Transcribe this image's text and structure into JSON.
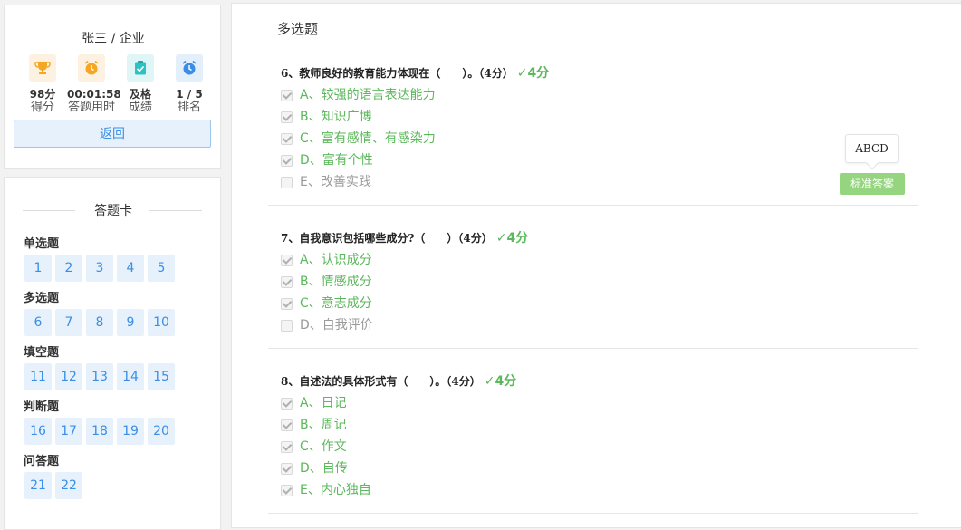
{
  "user": {
    "name": "张三 / 企业",
    "stats": [
      {
        "icon": "trophy-icon",
        "color": "#f5a623",
        "bg": "#fdf2e1",
        "value": "98分",
        "label": "得分"
      },
      {
        "icon": "alarm-clock-icon",
        "color": "#f5a623",
        "bg": "#fdf2e1",
        "value": "00:01:58",
        "label": "答题用时"
      },
      {
        "icon": "clipboard-check-icon",
        "color": "#2ec1c1",
        "bg": "#e0f6f6",
        "value": "及格",
        "label": "成绩"
      },
      {
        "icon": "alarm-clock-icon",
        "color": "#3a8ee6",
        "bg": "#e3effb",
        "value": "1 / 5",
        "label": "排名"
      }
    ],
    "back_label": "返回"
  },
  "answer_card": {
    "title": "答题卡",
    "sections": [
      {
        "title": "单选题",
        "numbers": [
          "1",
          "2",
          "3",
          "4",
          "5"
        ]
      },
      {
        "title": "多选题",
        "numbers": [
          "6",
          "7",
          "8",
          "9",
          "10"
        ]
      },
      {
        "title": "填空题",
        "numbers": [
          "11",
          "12",
          "13",
          "14",
          "15"
        ]
      },
      {
        "title": "判断题",
        "numbers": [
          "16",
          "17",
          "18",
          "19",
          "20"
        ]
      },
      {
        "title": "问答题",
        "numbers": [
          "21",
          "22"
        ]
      }
    ]
  },
  "main": {
    "section_title": "多选题",
    "questions": [
      {
        "title": "6、教师良好的教育能力体现在（　　）。（4分）",
        "score": "4分",
        "options": [
          {
            "text": "A、较强的语言表达能力",
            "checked": true,
            "correct": true
          },
          {
            "text": "B、知识广博",
            "checked": true,
            "correct": true
          },
          {
            "text": "C、富有感情、有感染力",
            "checked": true,
            "correct": true
          },
          {
            "text": "D、富有个性",
            "checked": true,
            "correct": true
          },
          {
            "text": "E、改善实践",
            "checked": false,
            "correct": false
          }
        ]
      },
      {
        "title": "7、自我意识包括哪些成分?（　　）（4分）",
        "score": "4分",
        "options": [
          {
            "text": "A、认识成分",
            "checked": true,
            "correct": true
          },
          {
            "text": "B、情感成分",
            "checked": true,
            "correct": true
          },
          {
            "text": "C、意志成分",
            "checked": true,
            "correct": true
          },
          {
            "text": "D、自我评价",
            "checked": false,
            "correct": false
          }
        ]
      },
      {
        "title": "8、自述法的具体形式有（　　）。（4分）",
        "score": "4分",
        "options": [
          {
            "text": "A、日记",
            "checked": true,
            "correct": true
          },
          {
            "text": "B、周记",
            "checked": true,
            "correct": true
          },
          {
            "text": "C、作文",
            "checked": true,
            "correct": true
          },
          {
            "text": "D、自传",
            "checked": true,
            "correct": true
          },
          {
            "text": "E、内心独自",
            "checked": true,
            "correct": true
          }
        ]
      }
    ],
    "standard_answer_popup": "ABCD",
    "standard_answer_button": "标准答案"
  }
}
